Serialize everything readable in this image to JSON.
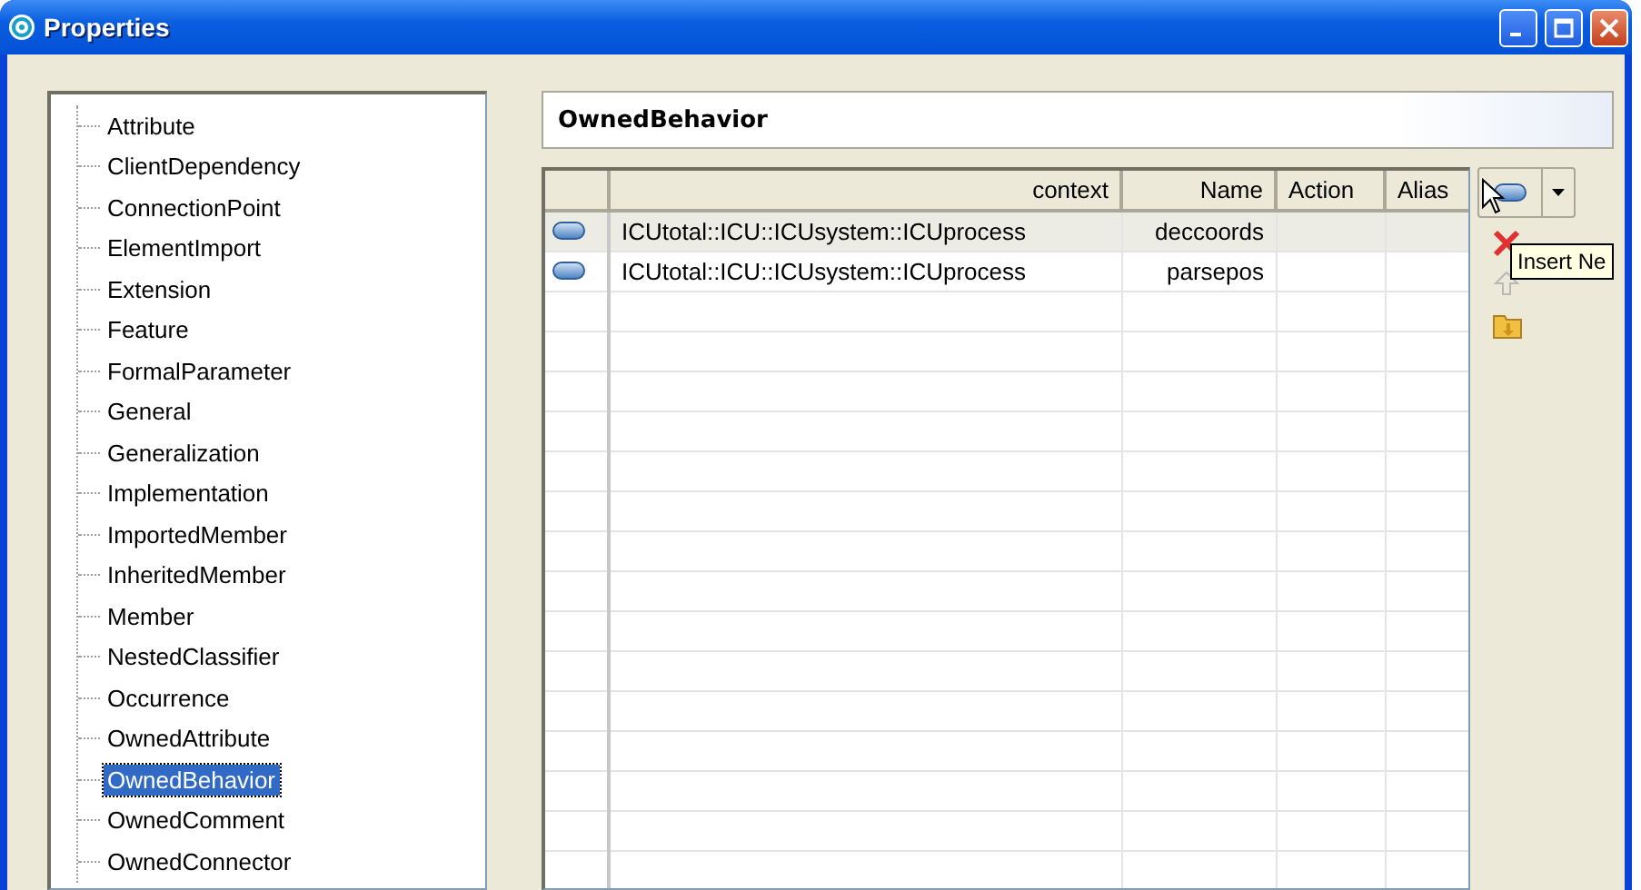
{
  "window": {
    "title": "Properties"
  },
  "tree": {
    "items": [
      {
        "label": "Attribute",
        "selected": false
      },
      {
        "label": "ClientDependency",
        "selected": false
      },
      {
        "label": "ConnectionPoint",
        "selected": false
      },
      {
        "label": "ElementImport",
        "selected": false
      },
      {
        "label": "Extension",
        "selected": false
      },
      {
        "label": "Feature",
        "selected": false
      },
      {
        "label": "FormalParameter",
        "selected": false
      },
      {
        "label": "General",
        "selected": false
      },
      {
        "label": "Generalization",
        "selected": false
      },
      {
        "label": "Implementation",
        "selected": false
      },
      {
        "label": "ImportedMember",
        "selected": false
      },
      {
        "label": "InheritedMember",
        "selected": false
      },
      {
        "label": "Member",
        "selected": false
      },
      {
        "label": "NestedClassifier",
        "selected": false
      },
      {
        "label": "Occurrence",
        "selected": false
      },
      {
        "label": "OwnedAttribute",
        "selected": false
      },
      {
        "label": "OwnedBehavior",
        "selected": true
      },
      {
        "label": "OwnedComment",
        "selected": false
      },
      {
        "label": "OwnedConnector",
        "selected": false
      }
    ]
  },
  "detail": {
    "heading": "OwnedBehavior",
    "table": {
      "columns": [
        "context",
        "Name",
        "Action",
        "Alias"
      ],
      "rows": [
        {
          "selected": true,
          "cells": [
            "ICUtotal::ICU::ICUsystem::ICUprocess",
            "deccoords",
            "",
            ""
          ]
        },
        {
          "selected": false,
          "cells": [
            "ICUtotal::ICU::ICUsystem::ICUprocess",
            "parsepos",
            "",
            ""
          ]
        }
      ]
    },
    "tooltip": "Insert Ne"
  }
}
